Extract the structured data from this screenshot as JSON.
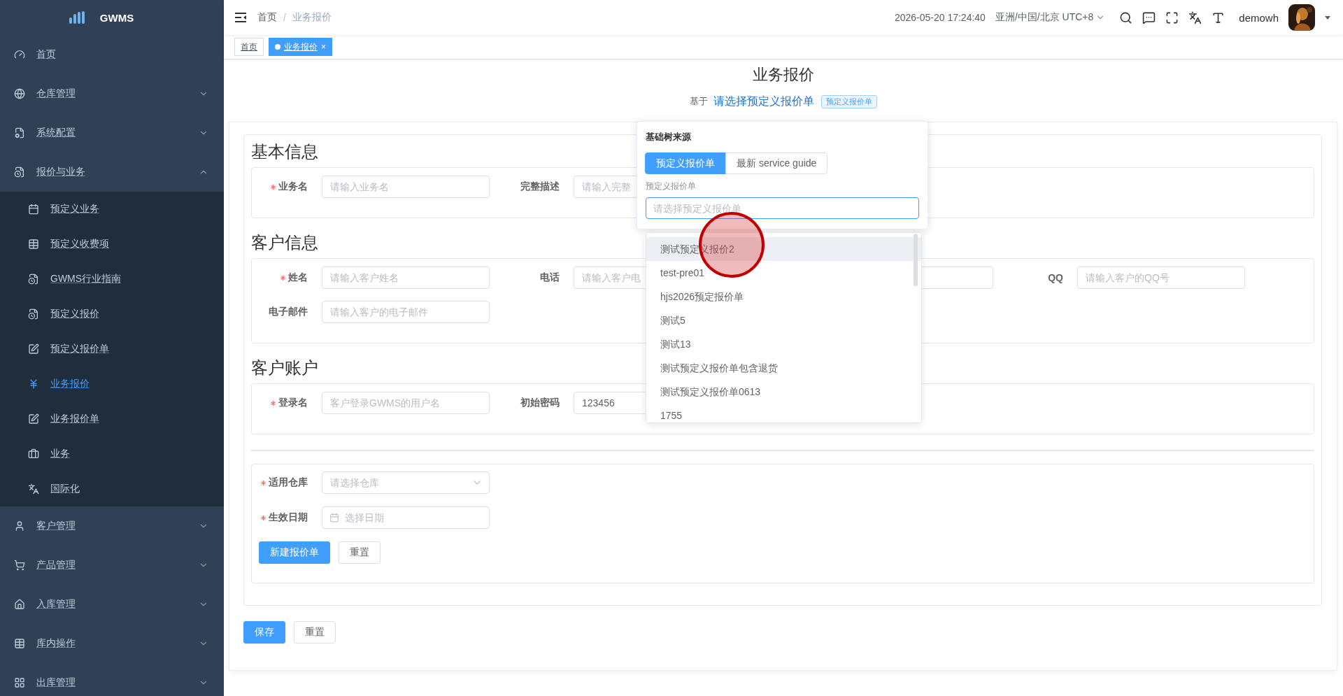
{
  "sidebar": {
    "logo": "GWMS",
    "items": [
      {
        "label": "首页"
      },
      {
        "label": "仓库管理",
        "expanded": false
      },
      {
        "label": "系统配置",
        "expanded": false
      },
      {
        "label": "报价与业务",
        "expanded": true,
        "children": [
          {
            "label": "预定义业务",
            "selected": false
          },
          {
            "label": "预定义收费项",
            "selected": false
          },
          {
            "label": "GWMS行业指南",
            "selected": false
          },
          {
            "label": "预定义报价",
            "selected": false
          },
          {
            "label": "预定义报价单",
            "selected": false
          },
          {
            "label": "业务报价",
            "selected": true
          },
          {
            "label": "业务报价单",
            "selected": false
          },
          {
            "label": "业务",
            "selected": false
          },
          {
            "label": "国际化",
            "selected": false
          }
        ]
      },
      {
        "label": "客户管理",
        "expanded": false
      },
      {
        "label": "产品管理",
        "expanded": false
      },
      {
        "label": "入库管理",
        "expanded": false
      },
      {
        "label": "库内操作",
        "expanded": false
      },
      {
        "label": "出库管理",
        "expanded": false
      }
    ]
  },
  "navbar": {
    "breadcrumb": [
      "首页",
      "业务报价"
    ],
    "breadcrumb_separator": "/",
    "datetime": "2026-05-20 17:24:40",
    "timezone": "亚洲/中国/北京 UTC+8",
    "user": "demowh"
  },
  "tags": [
    {
      "label": "首页",
      "selected": false
    },
    {
      "label": "业务报价",
      "selected": true,
      "close": "×"
    }
  ],
  "page": {
    "title": "业务报价",
    "basis": {
      "prefix": "基于",
      "link": "请选择预定义报价单",
      "tag": "预定义报价单"
    },
    "sections": [
      {
        "heading": "基本信息",
        "rows": [
          [
            {
              "kind": "input",
              "label": "业务名",
              "required": true,
              "placeholder": "请输入业务名"
            },
            {
              "kind": "input",
              "label": "完整描述",
              "required": false,
              "placeholder": "请输入完整"
            }
          ]
        ]
      },
      {
        "heading": "客户信息",
        "rows": [
          [
            {
              "kind": "input",
              "label": "姓名",
              "required": true,
              "placeholder": "请输入客户姓名"
            },
            {
              "kind": "input",
              "label": "电话",
              "required": false,
              "placeholder": "请输入客户电"
            },
            {
              "kind": "input"
            },
            {
              "kind": "input",
              "label": "QQ",
              "required": false,
              "placeholder": "请输入客户的QQ号"
            }
          ],
          [
            {
              "kind": "input",
              "label": "电子邮件",
              "required": false,
              "placeholder": "请输入客户的电子邮件"
            }
          ]
        ]
      },
      {
        "heading": "客户账户",
        "rows": [
          [
            {
              "kind": "input",
              "label": "登录名",
              "required": true,
              "placeholder": "客户登录GWMS的用户名"
            },
            {
              "kind": "input",
              "label": "初始密码",
              "required": false,
              "value": "123456"
            }
          ]
        ]
      }
    ],
    "final_section": {
      "fields": [
        {
          "kind": "select",
          "label": "适用仓库",
          "required": true,
          "placeholder": "请选择仓库"
        },
        {
          "kind": "date",
          "label": "生效日期",
          "required": true,
          "placeholder": "选择日期"
        }
      ],
      "buttons": [
        {
          "label": "新建报价单",
          "primary": true
        },
        {
          "label": "重置",
          "primary": false
        }
      ]
    },
    "buttons": [
      {
        "label": "保存",
        "primary": true
      },
      {
        "label": "重置",
        "primary": false
      }
    ]
  },
  "popover": {
    "title": "基础树来源",
    "options": [
      {
        "label": "预定义报价单",
        "selected": true
      },
      {
        "label": "最新 service guide",
        "selected": false
      }
    ],
    "field_label": "预定义报价单",
    "placeholder": "请选择预定义报价单"
  },
  "dropdown": {
    "items": [
      {
        "label": "测试预定义报价2",
        "highlighted": true
      },
      {
        "label": "test-pre01",
        "highlighted": false
      },
      {
        "label": "hjs2026预定报价单",
        "highlighted": false
      },
      {
        "label": "测试5",
        "highlighted": false
      },
      {
        "label": "测试13",
        "highlighted": false
      },
      {
        "label": "测试预定义报价单包含退货",
        "highlighted": false
      },
      {
        "label": "测试预定义报价单0613",
        "highlighted": false
      },
      {
        "label": "1755",
        "highlighted": false
      }
    ]
  },
  "click_marker": true
}
